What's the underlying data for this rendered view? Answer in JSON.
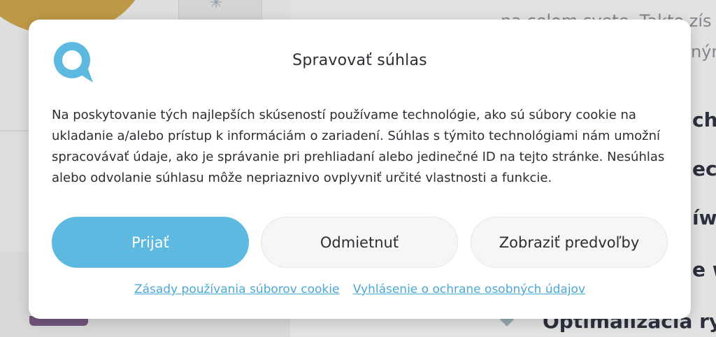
{
  "dialog": {
    "title": "Spravovať súhlas",
    "message": "Na poskytovanie tých najlepších skúseností používame technológie, ako sú súbory cookie na ukladanie a/alebo prístup k informáciám o zariadení. Súhlas s týmito technológiami nám umožní spracovávať údaje, ako je správanie pri prehliadaní alebo jedinečné ID na tejto stránke. Nesúhlas alebo odvolanie súhlasu môže nepriaznivo ovplyvniť určité vlastnosti a funkcie.",
    "buttons": {
      "accept": "Prijať",
      "deny": "Odmietnuť",
      "preferences": "Zobraziť predvoľby"
    },
    "links": {
      "cookie_policy": "Zásady používania súborov cookie",
      "privacy_policy": "Vyhlásenie o ochrane osobných údajov"
    },
    "logo_icon": "chat-bubble-logo-icon"
  },
  "background": {
    "text_line_1": "na celom svete. Takto zís",
    "text_line_2": "ným",
    "heading_1": "chn",
    "heading_2": "ech",
    "heading_3": "íwo",
    "heading_4": "e w",
    "heading_5": "Optimalizácia ry"
  },
  "colors": {
    "accent": "#5db9df",
    "link": "#4aa8d6",
    "text": "#2b2f33",
    "dialog_bg": "#ffffff"
  }
}
